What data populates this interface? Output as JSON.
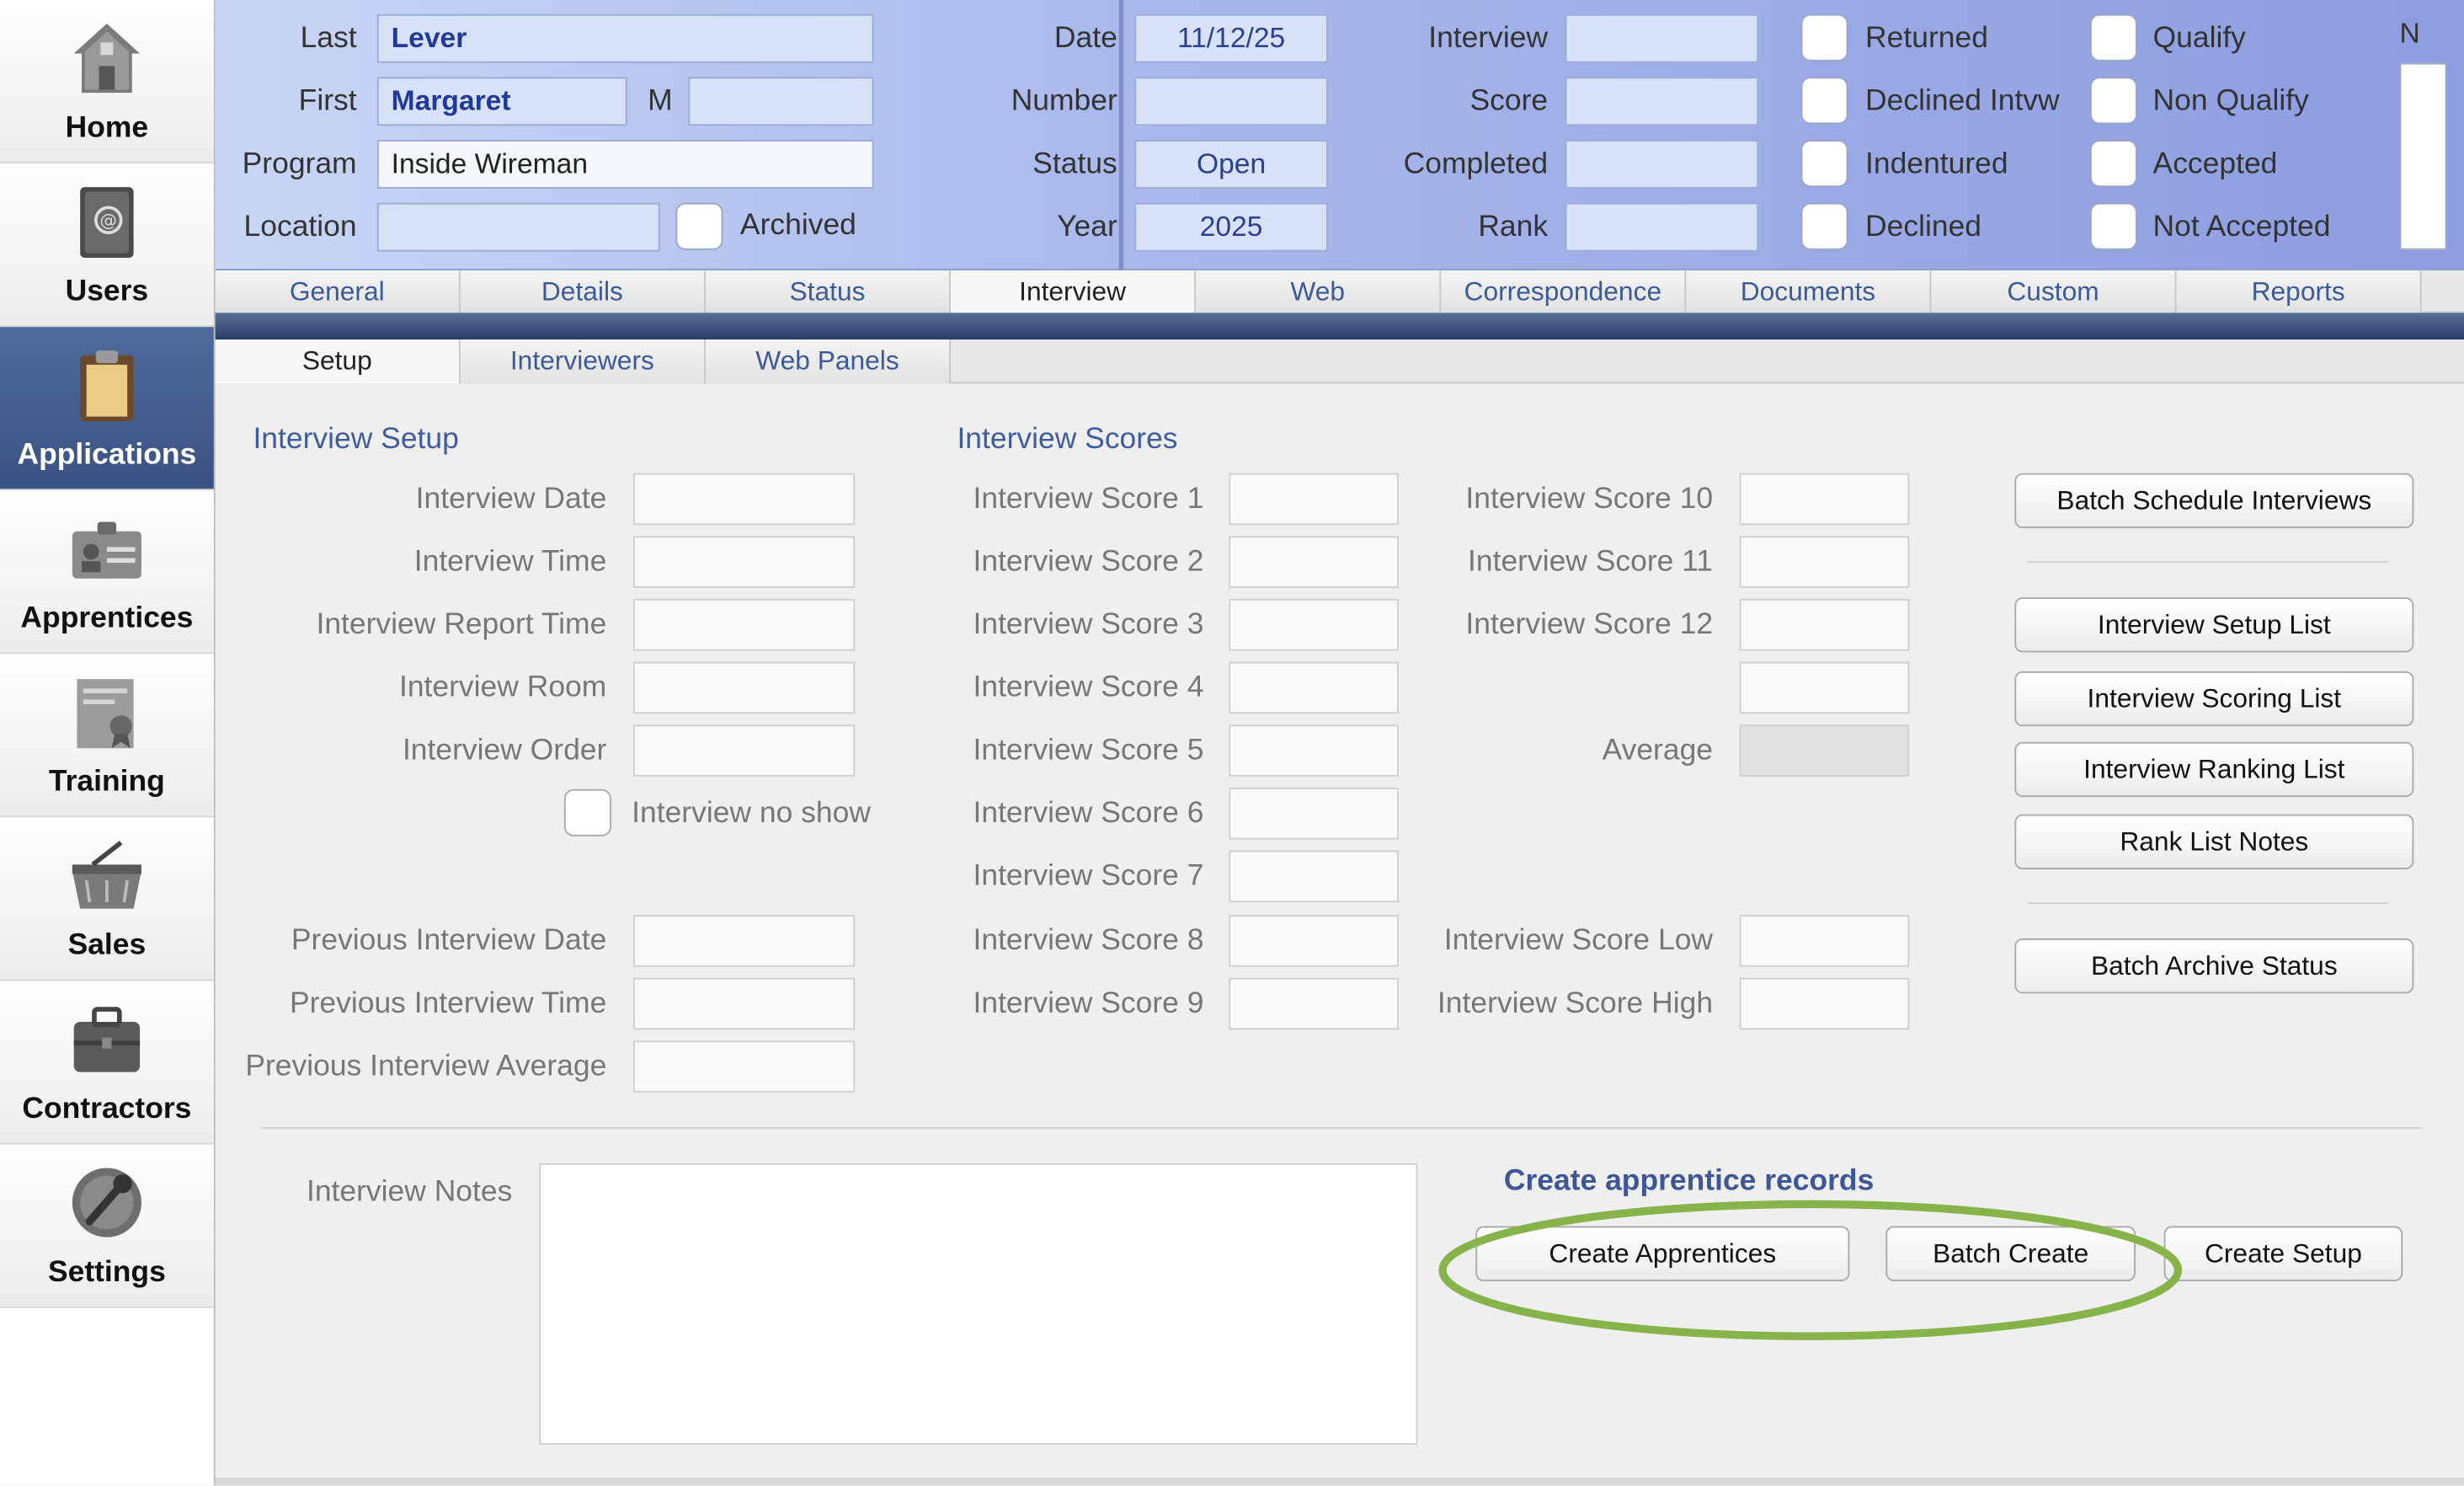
{
  "sidebar": {
    "items": [
      {
        "label": "Home",
        "icon": "home-icon"
      },
      {
        "label": "Users",
        "icon": "address-book-icon"
      },
      {
        "label": "Applications",
        "icon": "clipboard-icon"
      },
      {
        "label": "Apprentices",
        "icon": "id-card-icon"
      },
      {
        "label": "Training",
        "icon": "certificate-icon"
      },
      {
        "label": "Sales",
        "icon": "basket-icon"
      },
      {
        "label": "Contractors",
        "icon": "briefcase-icon"
      },
      {
        "label": "Settings",
        "icon": "wrench-icon"
      }
    ],
    "active": "Applications"
  },
  "header": {
    "last_label": "Last",
    "last_value": "Lever",
    "first_label": "First",
    "first_value": "Margaret",
    "middle_label": "M",
    "middle_value": "",
    "program_label": "Program",
    "program_value": "Inside Wireman",
    "location_label": "Location",
    "location_value": "",
    "archived_label": "Archived",
    "date_label": "Date",
    "date_value": "11/12/25",
    "number_label": "Number",
    "number_value": "",
    "status_label": "Status",
    "status_value": "Open",
    "year_label": "Year",
    "year_value": "2025",
    "interview_label": "Interview",
    "interview_value": "",
    "score_label": "Score",
    "score_value": "",
    "completed_label": "Completed",
    "completed_value": "",
    "rank_label": "Rank",
    "rank_value": "",
    "checks_col1": [
      "Returned",
      "Declined Intvw",
      "Indentured",
      "Declined"
    ],
    "checks_col2": [
      "Qualify",
      "Non Qualify",
      "Accepted",
      "Not Accepted"
    ],
    "corner_label": "N"
  },
  "tabs": [
    "General",
    "Details",
    "Status",
    "Interview",
    "Web",
    "Correspondence",
    "Documents",
    "Custom",
    "Reports"
  ],
  "active_tab": "Interview",
  "subtabs": [
    "Setup",
    "Interviewers",
    "Web Panels"
  ],
  "active_subtab": "Setup",
  "setup": {
    "title": "Interview Setup",
    "fields": [
      "Interview Date",
      "Interview Time",
      "Interview Report Time",
      "Interview Room",
      "Interview Order"
    ],
    "no_show_label": "Interview no show",
    "previous_fields": [
      "Previous Interview Date",
      "Previous Interview Time",
      "Previous Interview Average"
    ]
  },
  "scores": {
    "title": "Interview Scores",
    "col1": [
      "Interview Score 1",
      "Interview Score 2",
      "Interview Score 3",
      "Interview Score 4",
      "Interview Score 5",
      "Interview Score 6",
      "Interview Score 7",
      "Interview Score 8",
      "Interview Score 9"
    ],
    "col2": [
      "Interview Score 10",
      "Interview Score 11",
      "Interview Score 12"
    ],
    "average_label": "Average",
    "low_label": "Interview Score Low",
    "high_label": "Interview Score High"
  },
  "actions": {
    "batch_schedule": "Batch Schedule Interviews",
    "setup_list": "Interview Setup List",
    "scoring_list": "Interview Scoring List",
    "ranking_list": "Interview Ranking List",
    "rank_notes": "Rank List Notes",
    "batch_archive": "Batch Archive Status"
  },
  "notes": {
    "label": "Interview Notes",
    "value": ""
  },
  "create": {
    "title": "Create apprentice records",
    "create_apprentices": "Create Apprentices",
    "batch_create": "Batch Create",
    "create_setup": "Create Setup"
  },
  "colors": {
    "accent": "#3f5d9e",
    "highlight_ring": "#86b34a",
    "active_nav": "#3a5283"
  }
}
